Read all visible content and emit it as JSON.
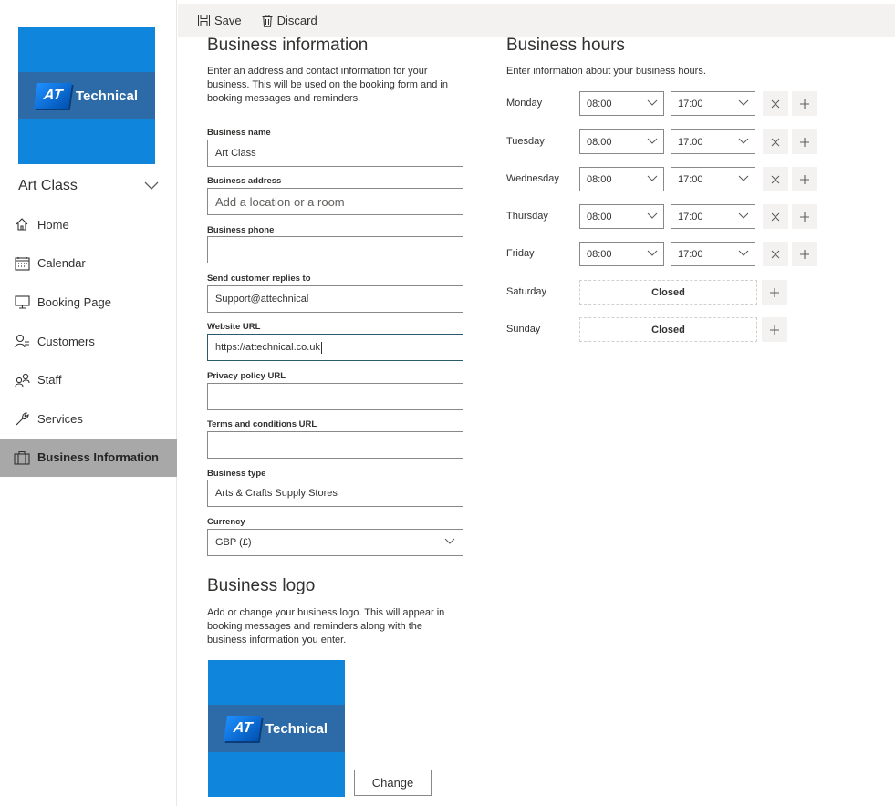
{
  "sidebar": {
    "logo": {
      "initials": "AT",
      "name": "Technical"
    },
    "business_name": "Art Class",
    "nav": [
      {
        "label": "Home",
        "icon": "home-icon"
      },
      {
        "label": "Calendar",
        "icon": "calendar-icon"
      },
      {
        "label": "Booking Page",
        "icon": "monitor-icon"
      },
      {
        "label": "Customers",
        "icon": "person-icon"
      },
      {
        "label": "Staff",
        "icon": "people-icon"
      },
      {
        "label": "Services",
        "icon": "wrench-icon"
      },
      {
        "label": "Business Information",
        "icon": "briefcase-icon",
        "active": true
      }
    ]
  },
  "toolbar": {
    "save_label": "Save",
    "discard_label": "Discard"
  },
  "business_info": {
    "title": "Business information",
    "description": "Enter an address and contact information for your business. This will be used on the booking form and in booking messages and reminders.",
    "fields": {
      "name": {
        "label": "Business name",
        "value": "Art Class"
      },
      "address": {
        "label": "Business address",
        "placeholder": "Add a location or a room"
      },
      "phone": {
        "label": "Business phone",
        "value": ""
      },
      "replies": {
        "label": "Send customer replies to",
        "value": "Support@attechnical"
      },
      "website": {
        "label": "Website URL",
        "value": "https://attechnical.co.uk"
      },
      "privacy": {
        "label": "Privacy policy URL",
        "value": ""
      },
      "terms": {
        "label": "Terms and conditions URL",
        "value": ""
      },
      "type": {
        "label": "Business type",
        "value": "Arts & Crafts Supply Stores"
      },
      "currency": {
        "label": "Currency",
        "value": "GBP (£)"
      }
    }
  },
  "business_logo": {
    "title": "Business logo",
    "description": "Add or change your business logo. This will appear in booking messages and reminders along with the business information you enter.",
    "change_label": "Change"
  },
  "hours": {
    "title": "Business hours",
    "description": "Enter information about your business hours.",
    "days": [
      {
        "day": "Monday",
        "open": "08:00",
        "close": "17:00"
      },
      {
        "day": "Tuesday",
        "open": "08:00",
        "close": "17:00"
      },
      {
        "day": "Wednesday",
        "open": "08:00",
        "close": "17:00"
      },
      {
        "day": "Thursday",
        "open": "08:00",
        "close": "17:00"
      },
      {
        "day": "Friday",
        "open": "08:00",
        "close": "17:00"
      },
      {
        "day": "Saturday",
        "closed_label": "Closed"
      },
      {
        "day": "Sunday",
        "closed_label": "Closed"
      }
    ]
  },
  "colors": {
    "logo_blue": "#0f86db",
    "logo_band": "#2c6aa8",
    "active_nav": "#a8a8a8",
    "toolbar_bg": "#f3f2f1"
  }
}
